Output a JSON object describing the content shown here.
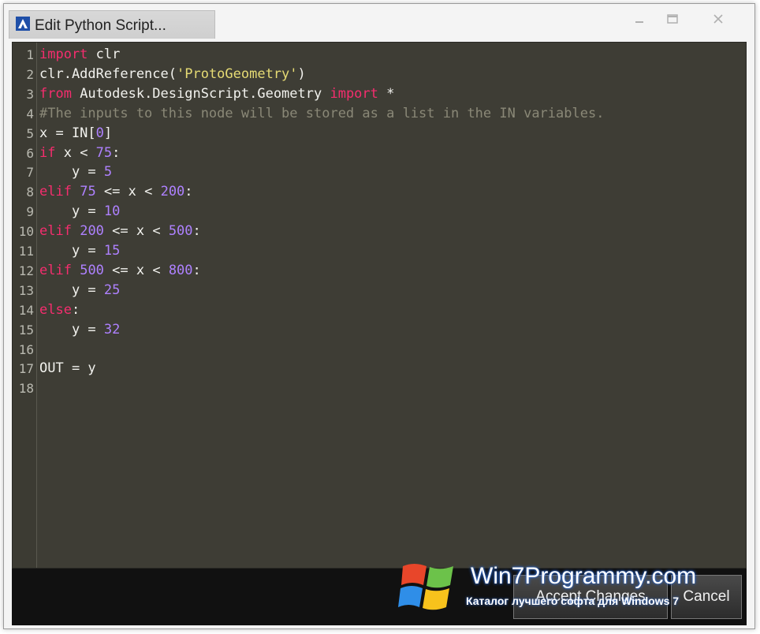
{
  "window": {
    "title": "Edit Python Script..."
  },
  "editor": {
    "lines": [
      {
        "n": "1",
        "parts": [
          {
            "t": "import",
            "c": "kw"
          },
          {
            "t": " clr",
            "c": ""
          }
        ]
      },
      {
        "n": "2",
        "parts": [
          {
            "t": "clr.AddReference(",
            "c": ""
          },
          {
            "t": "'ProtoGeometry'",
            "c": "str"
          },
          {
            "t": ")",
            "c": ""
          }
        ]
      },
      {
        "n": "3",
        "parts": [
          {
            "t": "from",
            "c": "kw"
          },
          {
            "t": " Autodesk.DesignScript.Geometry ",
            "c": ""
          },
          {
            "t": "import",
            "c": "kw"
          },
          {
            "t": " *",
            "c": ""
          }
        ]
      },
      {
        "n": "4",
        "parts": [
          {
            "t": "#The inputs to this node will be stored as a list in the IN variables.",
            "c": "cm"
          }
        ]
      },
      {
        "n": "5",
        "parts": [
          {
            "t": "x = IN[",
            "c": ""
          },
          {
            "t": "0",
            "c": "num"
          },
          {
            "t": "]",
            "c": ""
          }
        ]
      },
      {
        "n": "6",
        "parts": [
          {
            "t": "if",
            "c": "kw"
          },
          {
            "t": " x < ",
            "c": ""
          },
          {
            "t": "75",
            "c": "num"
          },
          {
            "t": ":",
            "c": ""
          }
        ]
      },
      {
        "n": "7",
        "parts": [
          {
            "t": "    y = ",
            "c": ""
          },
          {
            "t": "5",
            "c": "num"
          }
        ]
      },
      {
        "n": "8",
        "parts": [
          {
            "t": "elif",
            "c": "kw"
          },
          {
            "t": " ",
            "c": ""
          },
          {
            "t": "75",
            "c": "num"
          },
          {
            "t": " <= x < ",
            "c": ""
          },
          {
            "t": "200",
            "c": "num"
          },
          {
            "t": ":",
            "c": ""
          }
        ]
      },
      {
        "n": "9",
        "parts": [
          {
            "t": "    y = ",
            "c": ""
          },
          {
            "t": "10",
            "c": "num"
          }
        ]
      },
      {
        "n": "10",
        "parts": [
          {
            "t": "elif",
            "c": "kw"
          },
          {
            "t": " ",
            "c": ""
          },
          {
            "t": "200",
            "c": "num"
          },
          {
            "t": " <= x < ",
            "c": ""
          },
          {
            "t": "500",
            "c": "num"
          },
          {
            "t": ":",
            "c": ""
          }
        ]
      },
      {
        "n": "11",
        "parts": [
          {
            "t": "    y = ",
            "c": ""
          },
          {
            "t": "15",
            "c": "num"
          }
        ]
      },
      {
        "n": "12",
        "parts": [
          {
            "t": "elif",
            "c": "kw"
          },
          {
            "t": " ",
            "c": ""
          },
          {
            "t": "500",
            "c": "num"
          },
          {
            "t": " <= x < ",
            "c": ""
          },
          {
            "t": "800",
            "c": "num"
          },
          {
            "t": ":",
            "c": ""
          }
        ]
      },
      {
        "n": "13",
        "parts": [
          {
            "t": "    y = ",
            "c": ""
          },
          {
            "t": "25",
            "c": "num"
          }
        ]
      },
      {
        "n": "14",
        "parts": [
          {
            "t": "else",
            "c": "kw"
          },
          {
            "t": ":",
            "c": ""
          }
        ]
      },
      {
        "n": "15",
        "parts": [
          {
            "t": "    y = ",
            "c": ""
          },
          {
            "t": "32",
            "c": "num"
          }
        ]
      },
      {
        "n": "16",
        "parts": []
      },
      {
        "n": "17",
        "parts": [
          {
            "t": "OUT = y",
            "c": ""
          }
        ]
      },
      {
        "n": "18",
        "parts": []
      }
    ]
  },
  "buttons": {
    "accept": "Accept Changes",
    "cancel": "Cancel"
  },
  "watermark": {
    "title": "Win7Programmy.com",
    "subtitle": "Каталог лучшего софта для Windows 7"
  },
  "colors": {
    "editor_bg": "#3e3d35",
    "keyword": "#f52d6e",
    "number": "#ae81ff",
    "string": "#e6db74",
    "comment": "#8a8877"
  }
}
